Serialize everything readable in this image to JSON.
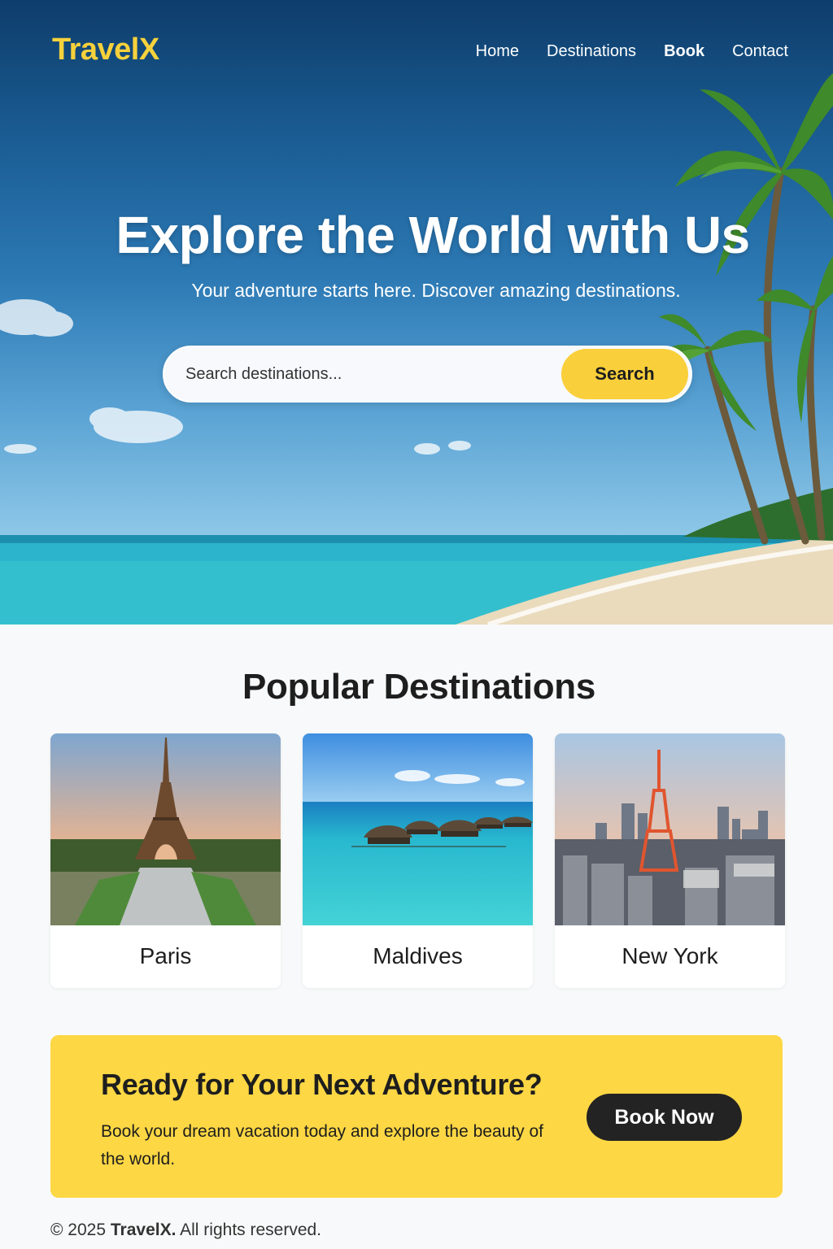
{
  "brand": {
    "name": "TravelX",
    "accent": "#f7d13c"
  },
  "nav": {
    "items": [
      {
        "label": "Home"
      },
      {
        "label": "Destinations"
      },
      {
        "label": "Book",
        "active": true
      },
      {
        "label": "Contact"
      }
    ]
  },
  "hero": {
    "title": "Explore the World with Us",
    "subtitle": "Your adventure starts here. Discover amazing destinations.",
    "search": {
      "placeholder": "Search destinations...",
      "button_label": "Search"
    }
  },
  "popular": {
    "title": "Popular Destinations",
    "cards": [
      {
        "name": "Paris"
      },
      {
        "name": "Maldives"
      },
      {
        "name": "New York"
      }
    ]
  },
  "cta": {
    "title": "Ready for Your Next Adventure?",
    "text": "Book your dream vacation today and explore the beauty of the world.",
    "button_label": "Book Now",
    "background": "#fdd744"
  },
  "footer": {
    "copyright_prefix": "© 2025",
    "brand": "TravelX.",
    "suffix": "All rights reserved."
  }
}
